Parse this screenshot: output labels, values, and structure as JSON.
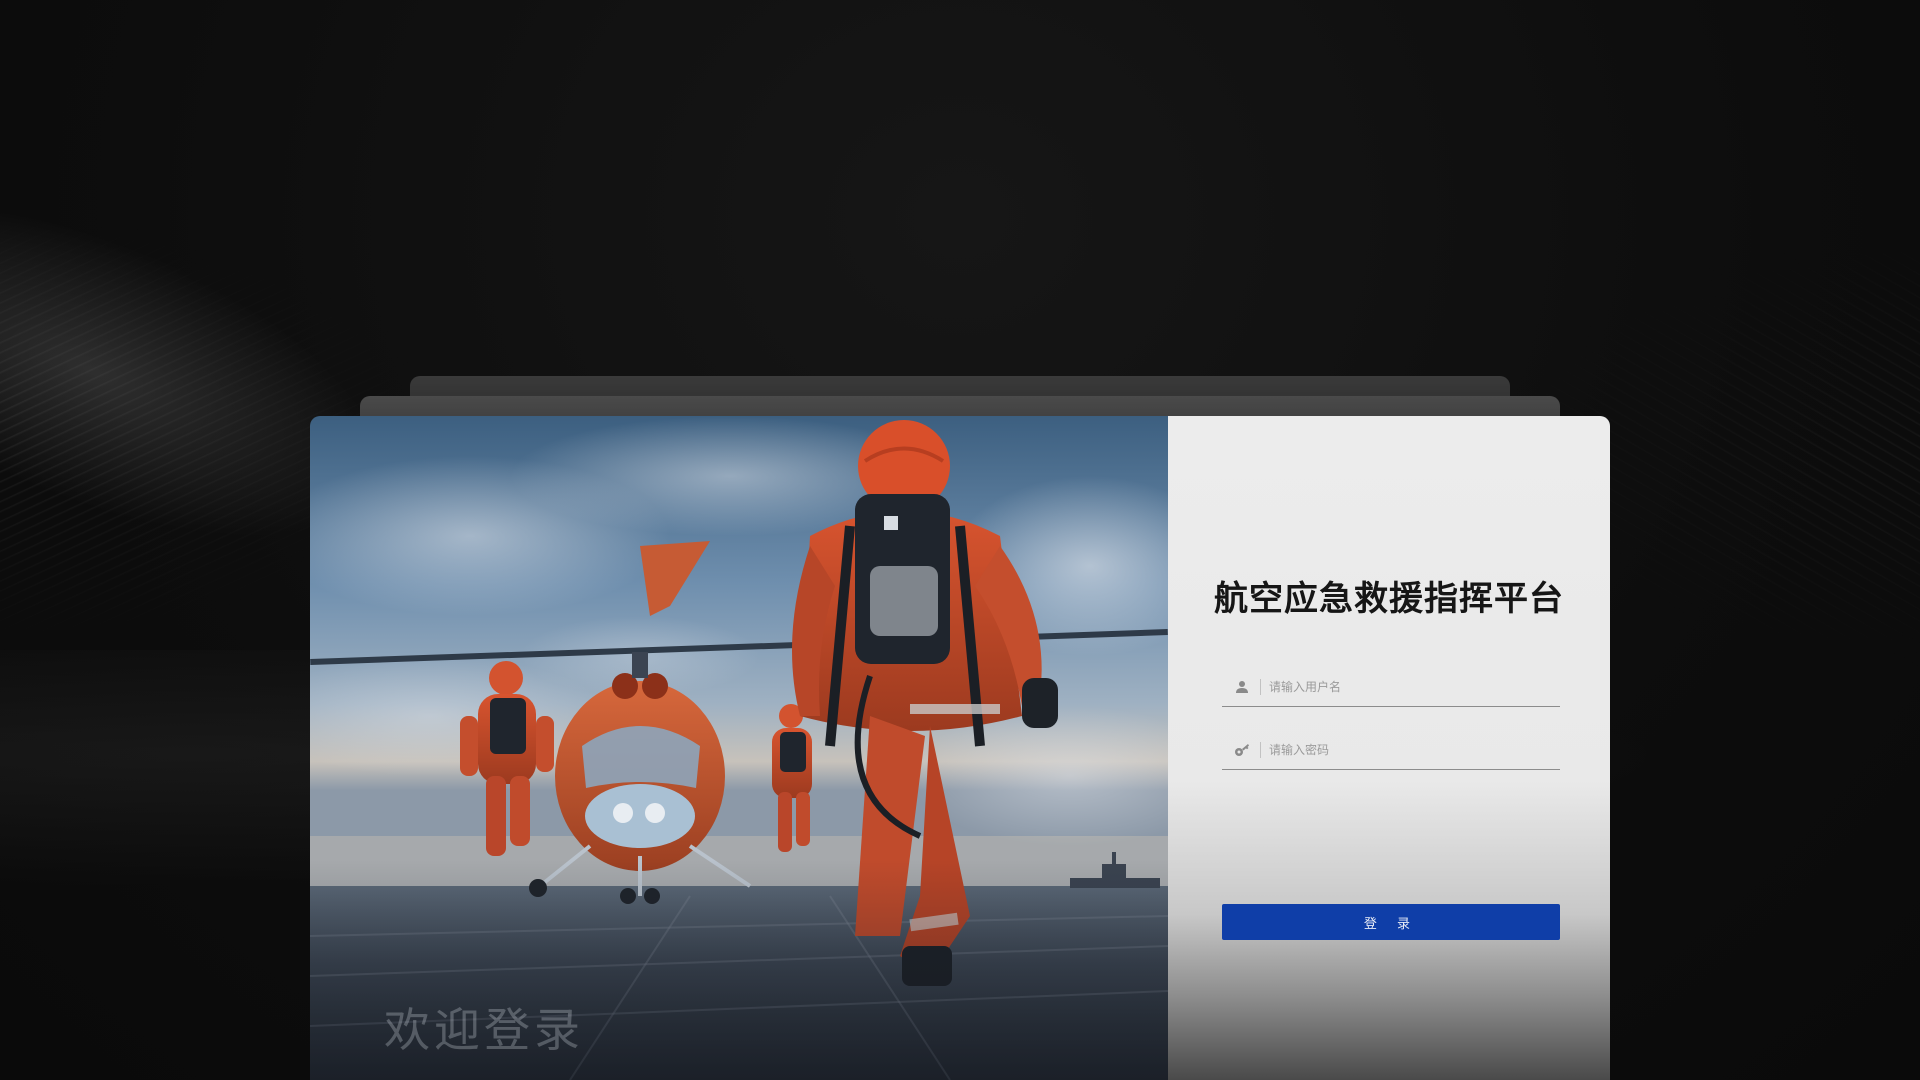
{
  "app": {
    "title": "航空应急救援指挥平台"
  },
  "hero": {
    "welcome_text": "欢迎登录"
  },
  "login": {
    "username_placeholder": "请输入用户名",
    "password_placeholder": "请输入密码",
    "submit_label": "登 录",
    "username_icon": "user-icon",
    "password_icon": "key-icon"
  },
  "colors": {
    "accent": "#0f3ea8",
    "background": "#0e0e0e",
    "panel": "#ececec",
    "title_text": "#161616"
  }
}
